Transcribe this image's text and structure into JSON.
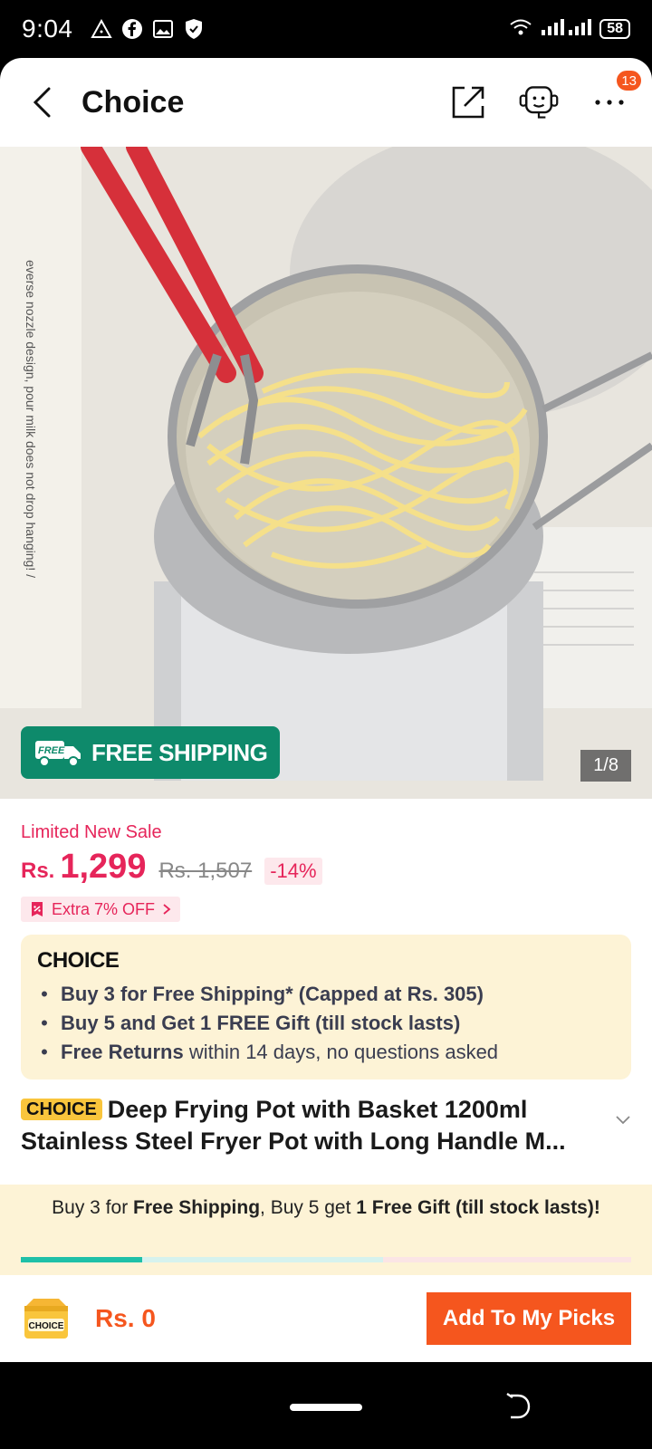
{
  "status_bar": {
    "time": "9:04",
    "battery": "58",
    "icons": [
      "warning-icon",
      "facebook-icon",
      "gallery-icon",
      "shield-icon",
      "wifi-icon",
      "signal-icon"
    ]
  },
  "header": {
    "title": "Choice",
    "notification_count": "13"
  },
  "gallery": {
    "side_text": "everse nozzle design, pour milk does not drop hanging! /",
    "free_shipping_badge": "FREE",
    "free_shipping_label": "FREE SHIPPING",
    "counter": "1/8"
  },
  "pricing": {
    "sale_label": "Limited New Sale",
    "currency": "Rs.",
    "price": "1,299",
    "original_price": "Rs. 1,507",
    "discount": "-14%",
    "extra_off": "Extra 7% OFF"
  },
  "choice_box": {
    "logo": "CHOICE",
    "items": [
      {
        "bold": "Buy 3 for  Free Shipping* (Capped at Rs. 305)",
        "rest": ""
      },
      {
        "bold": "Buy 5 and Get 1 FREE Gift (till stock lasts)",
        "rest": ""
      },
      {
        "bold": "Free Returns",
        "rest": " within 14 days, no questions asked"
      }
    ]
  },
  "product": {
    "choice_tag": "CHOICE",
    "title": "Deep Frying Pot with Basket 1200ml Stainless Steel Fryer Pot with Long Handle M..."
  },
  "promo": {
    "p1": "Buy 3 for ",
    "p2": "Free Shipping",
    "p3": ", Buy 5 get ",
    "p4": "1 Free Gift (till stock lasts)!",
    "progress_fraction": 0.2
  },
  "bottom_bar": {
    "cart_label": "CHOICE",
    "total": "Rs. 0",
    "add_button": "Add To My Picks"
  },
  "colors": {
    "accent": "#f5561e",
    "price": "#e6255a",
    "free_shipping_bg": "#0e8a6b",
    "choice_bg": "#fdf3d6"
  }
}
